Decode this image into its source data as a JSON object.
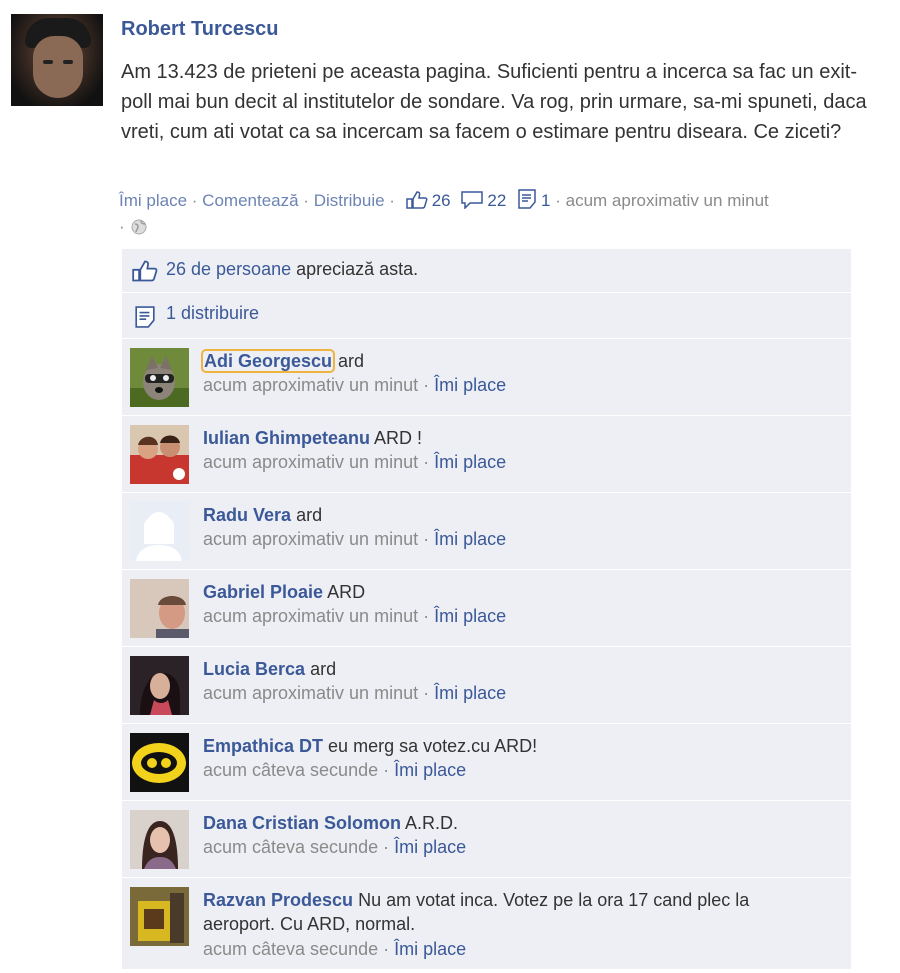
{
  "post": {
    "author": "Robert Turcescu",
    "text": "Am 13.423 de prieteni pe aceasta pagina. Suficienti pentru a incerca sa fac un exit-poll mai bun decit al institutelor de sondare. Va rog, prin urmare, sa-mi spuneti, daca vreti, cum ati votat ca sa incercam sa facem o estimare pentru diseara. Ce ziceti?",
    "actions": {
      "like": "Îmi place",
      "comment": "Comentează",
      "share": "Distribuie"
    },
    "counts": {
      "likes": "26",
      "comments": "22",
      "shares": "1"
    },
    "time": "acum aproximativ un minut",
    "separator": "·"
  },
  "feedback": {
    "likes_link": "26 de persoane",
    "likes_text": " apreciază asta.",
    "shares_link": "1 distribuire"
  },
  "comments": [
    {
      "name": "Adi Georgescu",
      "text": "ard",
      "time": "acum aproximativ un minut",
      "like": "Îmi place"
    },
    {
      "name": "Iulian Ghimpeteanu",
      "text": "ARD !",
      "time": "acum aproximativ un minut",
      "like": "Îmi place"
    },
    {
      "name": "Radu Vera",
      "text": "ard",
      "time": "acum aproximativ un minut",
      "like": "Îmi place"
    },
    {
      "name": "Gabriel Ploaie",
      "text": "ARD",
      "time": "acum aproximativ un minut",
      "like": "Îmi place"
    },
    {
      "name": "Lucia Berca",
      "text": "ard",
      "time": "acum aproximativ un minut",
      "like": "Îmi place"
    },
    {
      "name": "Empathica DT",
      "text": "eu merg sa votez.cu ARD!",
      "time": "acum câteva secunde",
      "like": "Îmi place"
    },
    {
      "name": "Dana Cristian Solomon",
      "text": "A.R.D.",
      "time": "acum câteva secunde",
      "like": "Îmi place"
    },
    {
      "name": "Razvan Prodescu",
      "text": "Nu am votat inca. Votez pe la ora 17 cand plec la aeroport. Cu ARD, normal.",
      "time": "acum câteva secunde",
      "like": "Îmi place"
    }
  ],
  "colors": {
    "link": "#3b5998",
    "panel": "#edeff4",
    "meta": "#8a8a8a"
  }
}
